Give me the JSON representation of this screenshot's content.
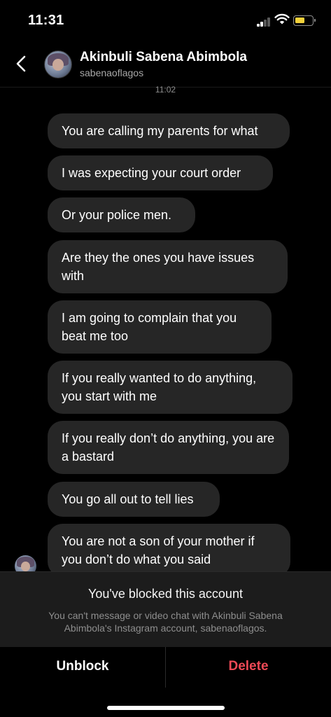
{
  "status_bar": {
    "time": "11:31",
    "battery_level": 0.6,
    "battery_color": "#f3d23b"
  },
  "header": {
    "back_icon": "chevron-left-icon",
    "name": "Akinbuli Sabena Abimbola",
    "username": "sabenaoflagos"
  },
  "timestamp": "11:02",
  "messages": [
    {
      "text": "You are calling my parents for what"
    },
    {
      "text": "I was expecting your court order"
    },
    {
      "text": "Or your police men."
    },
    {
      "text": "Are they the ones you have issues with"
    },
    {
      "text": "I am going to complain that you beat me too"
    },
    {
      "text": "If you really wanted to do anything, you start with me"
    },
    {
      "text": "If you really don’t do anything, you are a bastard"
    },
    {
      "text": "You go all out to tell lies"
    },
    {
      "text": "You are not a son of your mother if you don’t do what you said"
    }
  ],
  "blocked": {
    "title": "You've blocked this account",
    "description": "You can't message or video chat with Akinbuli Sabena Abimbola's Instagram account, sabenaoflagos."
  },
  "actions": {
    "unblock_label": "Unblock",
    "delete_label": "Delete",
    "delete_color": "#ed4956"
  }
}
